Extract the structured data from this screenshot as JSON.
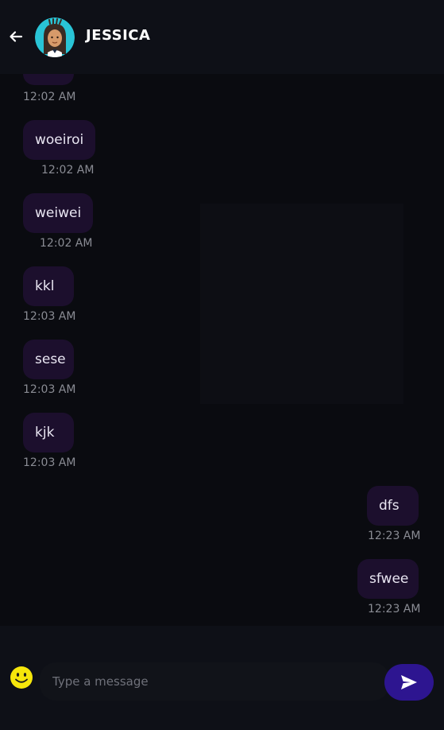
{
  "header": {
    "contact_name": "JESSICA"
  },
  "messages": [
    {
      "text": "",
      "time": "12:02 AM",
      "side": "left"
    },
    {
      "text": "woeiroi",
      "time": "12:02 AM",
      "side": "left"
    },
    {
      "text": "weiwei",
      "time": "12:02 AM",
      "side": "left"
    },
    {
      "text": "kkl",
      "time": "12:03 AM",
      "side": "left"
    },
    {
      "text": "sese",
      "time": "12:03 AM",
      "side": "left"
    },
    {
      "text": "kjk",
      "time": "12:03 AM",
      "side": "left"
    },
    {
      "text": "dfs",
      "time": "12:23 AM",
      "side": "right"
    },
    {
      "text": "sfwee",
      "time": "12:23 AM",
      "side": "right"
    }
  ],
  "composer": {
    "placeholder": "Type a message",
    "value": ""
  },
  "colors": {
    "bubble": "#1c0f2d",
    "send_button": "#2d1590",
    "emoji": "#f5e60b",
    "avatar_ring": "#29c4d6"
  },
  "icons": {
    "back": "arrow-left-icon",
    "emoji": "smiley-icon",
    "send": "send-icon"
  }
}
